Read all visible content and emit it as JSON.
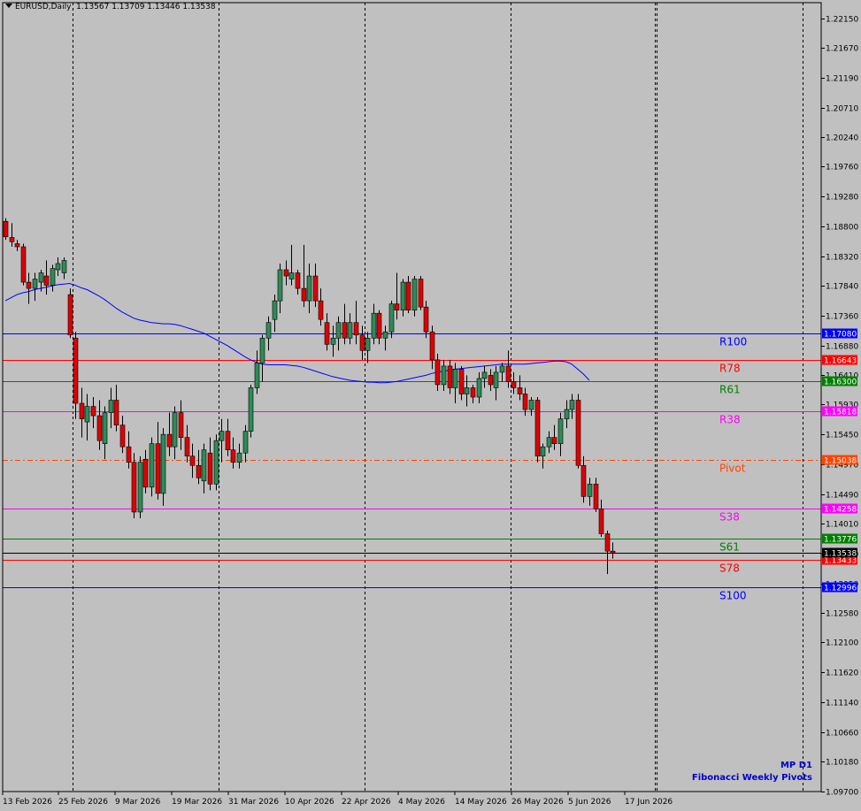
{
  "header": {
    "symbol": "EURUSD,Daily",
    "ohlc": "1.13567 1.13709 1.13446 1.13538"
  },
  "branding": {
    "line1": "MP D1",
    "line2": "Fibonacci Weekly Pivots"
  },
  "colors": {
    "background": "#c0c0c0",
    "bull": "#2e8b57",
    "bear": "#e00000",
    "ma": "#0000ff"
  },
  "chart_data": {
    "type": "candlestick",
    "ylim": [
      1.097,
      1.224
    ],
    "y_ticks": [
      "1.22150",
      "1.21670",
      "1.21190",
      "1.20710",
      "1.20240",
      "1.19760",
      "1.19280",
      "1.18800",
      "1.18320",
      "1.17840",
      "1.17360",
      "1.16880",
      "1.16410",
      "1.15930",
      "1.15450",
      "1.14970",
      "1.14490",
      "1.14010",
      "1.13530",
      "1.13050",
      "1.12580",
      "1.12100",
      "1.11620",
      "1.11140",
      "1.10660",
      "1.10180",
      "1.09700"
    ],
    "x_labels": [
      "13 Feb 2026",
      "25 Feb 2026",
      "9 Mar 2026",
      "19 Mar 2026",
      "31 Mar 2026",
      "10 Apr 2026",
      "22 Apr 2026",
      "4 May 2026",
      "14 May 2026",
      "26 May 2026",
      "5 Jun 2026",
      "17 Jun 2026"
    ],
    "period_separators": [
      12,
      37,
      62,
      87,
      112,
      137
    ],
    "candles": [
      [
        1.1888,
        1.1893,
        1.1858,
        1.1863
      ],
      [
        1.1862,
        1.1885,
        1.1847,
        1.1855
      ],
      [
        1.1852,
        1.1858,
        1.184,
        1.1847
      ],
      [
        1.1847,
        1.1852,
        1.1785,
        1.179
      ],
      [
        1.179,
        1.1805,
        1.1755,
        1.178
      ],
      [
        1.178,
        1.1805,
        1.176,
        1.1795
      ],
      [
        1.179,
        1.181,
        1.1775,
        1.1805
      ],
      [
        1.18,
        1.1825,
        1.177,
        1.1785
      ],
      [
        1.1785,
        1.1818,
        1.1775,
        1.1812
      ],
      [
        1.181,
        1.183,
        1.18,
        1.182
      ],
      [
        1.1805,
        1.183,
        1.1795,
        1.1825
      ],
      [
        1.177,
        1.178,
        1.17,
        1.1705
      ],
      [
        1.17,
        1.171,
        1.157,
        1.1595
      ],
      [
        1.1595,
        1.162,
        1.154,
        1.157
      ],
      [
        1.1565,
        1.161,
        1.1535,
        1.159
      ],
      [
        1.159,
        1.1605,
        1.1555,
        1.1575
      ],
      [
        1.1575,
        1.16,
        1.152,
        1.1535
      ],
      [
        1.153,
        1.159,
        1.1505,
        1.158
      ],
      [
        1.158,
        1.162,
        1.1555,
        1.16
      ],
      [
        1.16,
        1.1625,
        1.155,
        1.156
      ],
      [
        1.156,
        1.1575,
        1.1515,
        1.1525
      ],
      [
        1.1525,
        1.155,
        1.149,
        1.15
      ],
      [
        1.15,
        1.1515,
        1.141,
        1.142
      ],
      [
        1.142,
        1.151,
        1.141,
        1.15
      ],
      [
        1.1505,
        1.152,
        1.145,
        1.146
      ],
      [
        1.146,
        1.154,
        1.1445,
        1.153
      ],
      [
        1.153,
        1.1565,
        1.144,
        1.145
      ],
      [
        1.145,
        1.1555,
        1.143,
        1.1545
      ],
      [
        1.1545,
        1.158,
        1.151,
        1.1525
      ],
      [
        1.1525,
        1.159,
        1.1505,
        1.158
      ],
      [
        1.158,
        1.16,
        1.152,
        1.154
      ],
      [
        1.154,
        1.156,
        1.15,
        1.151
      ],
      [
        1.151,
        1.153,
        1.1475,
        1.1495
      ],
      [
        1.1495,
        1.152,
        1.1465,
        1.1475
      ],
      [
        1.147,
        1.153,
        1.145,
        1.152
      ],
      [
        1.1515,
        1.154,
        1.1455,
        1.1465
      ],
      [
        1.1465,
        1.1545,
        1.1455,
        1.1535
      ],
      [
        1.1535,
        1.157,
        1.15,
        1.155
      ],
      [
        1.155,
        1.157,
        1.151,
        1.152
      ],
      [
        1.152,
        1.154,
        1.149,
        1.15
      ],
      [
        1.15,
        1.153,
        1.149,
        1.1515
      ],
      [
        1.1515,
        1.156,
        1.15,
        1.155
      ],
      [
        1.155,
        1.1625,
        1.154,
        1.162
      ],
      [
        1.162,
        1.168,
        1.161,
        1.166
      ],
      [
        1.166,
        1.1705,
        1.163,
        1.17
      ],
      [
        1.17,
        1.1735,
        1.168,
        1.1725
      ],
      [
        1.173,
        1.177,
        1.171,
        1.176
      ],
      [
        1.176,
        1.182,
        1.174,
        1.181
      ],
      [
        1.181,
        1.1825,
        1.1785,
        1.18
      ],
      [
        1.1795,
        1.185,
        1.1785,
        1.1805
      ],
      [
        1.1805,
        1.181,
        1.177,
        1.178
      ],
      [
        1.178,
        1.185,
        1.175,
        1.176
      ],
      [
        1.176,
        1.182,
        1.174,
        1.18
      ],
      [
        1.18,
        1.182,
        1.175,
        1.176
      ],
      [
        1.176,
        1.178,
        1.172,
        1.173
      ],
      [
        1.1725,
        1.174,
        1.168,
        1.169
      ],
      [
        1.169,
        1.172,
        1.167,
        1.17
      ],
      [
        1.17,
        1.1735,
        1.168,
        1.1725
      ],
      [
        1.1725,
        1.1755,
        1.169,
        1.17
      ],
      [
        1.17,
        1.174,
        1.169,
        1.1725
      ],
      [
        1.1725,
        1.176,
        1.169,
        1.1705
      ],
      [
        1.1705,
        1.172,
        1.1665,
        1.168
      ],
      [
        1.168,
        1.171,
        1.166,
        1.17
      ],
      [
        1.17,
        1.1755,
        1.169,
        1.174
      ],
      [
        1.174,
        1.1745,
        1.169,
        1.17
      ],
      [
        1.17,
        1.172,
        1.168,
        1.171
      ],
      [
        1.171,
        1.176,
        1.17,
        1.1755
      ],
      [
        1.1755,
        1.1805,
        1.173,
        1.1745
      ],
      [
        1.1745,
        1.1795,
        1.1735,
        1.179
      ],
      [
        1.179,
        1.18,
        1.174,
        1.1745
      ],
      [
        1.1745,
        1.18,
        1.1735,
        1.1795
      ],
      [
        1.1795,
        1.18,
        1.1745,
        1.175
      ],
      [
        1.175,
        1.176,
        1.17,
        1.171
      ],
      [
        1.171,
        1.172,
        1.165,
        1.1665
      ],
      [
        1.1665,
        1.1675,
        1.1615,
        1.1625
      ],
      [
        1.1625,
        1.1665,
        1.1615,
        1.1655
      ],
      [
        1.1655,
        1.1665,
        1.161,
        1.162
      ],
      [
        1.162,
        1.166,
        1.1595,
        1.165
      ],
      [
        1.165,
        1.1655,
        1.16,
        1.161
      ],
      [
        1.161,
        1.164,
        1.159,
        1.162
      ],
      [
        1.162,
        1.1625,
        1.1595,
        1.1605
      ],
      [
        1.1605,
        1.1645,
        1.1595,
        1.1635
      ],
      [
        1.1635,
        1.1655,
        1.162,
        1.1645
      ],
      [
        1.164,
        1.165,
        1.1615,
        1.1625
      ],
      [
        1.162,
        1.1655,
        1.16,
        1.1645
      ],
      [
        1.1645,
        1.166,
        1.163,
        1.1655
      ],
      [
        1.1655,
        1.168,
        1.162,
        1.163
      ],
      [
        1.163,
        1.1645,
        1.161,
        1.162
      ],
      [
        1.162,
        1.164,
        1.16,
        1.161
      ],
      [
        1.161,
        1.162,
        1.1575,
        1.1585
      ],
      [
        1.1585,
        1.1605,
        1.1575,
        1.16
      ],
      [
        1.16,
        1.1605,
        1.15,
        1.151
      ],
      [
        1.151,
        1.153,
        1.149,
        1.1525
      ],
      [
        1.1525,
        1.155,
        1.1515,
        1.154
      ],
      [
        1.154,
        1.156,
        1.152,
        1.153
      ],
      [
        1.153,
        1.158,
        1.151,
        1.157
      ],
      [
        1.157,
        1.16,
        1.1555,
        1.1585
      ],
      [
        1.1585,
        1.161,
        1.157,
        1.16
      ],
      [
        1.16,
        1.161,
        1.149,
        1.1495
      ],
      [
        1.1495,
        1.151,
        1.1435,
        1.1445
      ],
      [
        1.1445,
        1.1475,
        1.143,
        1.1465
      ],
      [
        1.1465,
        1.1475,
        1.142,
        1.1425
      ],
      [
        1.1425,
        1.144,
        1.138,
        1.1385
      ],
      [
        1.1385,
        1.139,
        1.132,
        1.1357
      ],
      [
        1.1357,
        1.1371,
        1.1345,
        1.1354
      ]
    ],
    "ma_series": [
      1.176,
      1.1765,
      1.177,
      1.1773,
      1.1775,
      1.1778,
      1.178,
      1.1782,
      1.1784,
      1.1786,
      1.1787,
      1.1788,
      1.1785,
      1.1781,
      1.1778,
      1.1773,
      1.1768,
      1.1762,
      1.1755,
      1.1748,
      1.1742,
      1.1737,
      1.1732,
      1.1729,
      1.1727,
      1.1725,
      1.1724,
      1.1723,
      1.1723,
      1.1722,
      1.172,
      1.1717,
      1.1714,
      1.1711,
      1.1708,
      1.1703,
      1.1698,
      1.1693,
      1.1688,
      1.1682,
      1.1676,
      1.167,
      1.1665,
      1.1661,
      1.1658,
      1.1657,
      1.1657,
      1.1657,
      1.1657,
      1.1656,
      1.1655,
      1.1653,
      1.165,
      1.1647,
      1.1644,
      1.1641,
      1.1638,
      1.1636,
      1.1634,
      1.1632,
      1.1631,
      1.163,
      1.1629,
      1.1629,
      1.1628,
      1.1628,
      1.1629,
      1.163,
      1.1632,
      1.1634,
      1.1636,
      1.1638,
      1.164,
      1.1643,
      1.1645,
      1.1647,
      1.1648,
      1.165,
      1.1651,
      1.1652,
      1.1653,
      1.1654,
      1.1655,
      1.1656,
      1.1657,
      1.1658,
      1.1658,
      1.1658,
      1.1658,
      1.1658,
      1.1659,
      1.166,
      1.1661,
      1.1662,
      1.1663,
      1.1663,
      1.1662,
      1.1658,
      1.165,
      1.1642,
      1.1632
    ],
    "pivot_levels": [
      {
        "name": "R100",
        "value": 1.1708,
        "price_label": "1.17080",
        "color": "#0000ff",
        "style": "solid"
      },
      {
        "name": "R78",
        "value": 1.16643,
        "price_label": "1.16643",
        "color": "#ff0000",
        "style": "solid"
      },
      {
        "name": "R61",
        "value": 1.163,
        "price_label": "1.16300",
        "color": "#008000",
        "style": "solid"
      },
      {
        "name": "R38",
        "value": 1.15818,
        "price_label": "1.15818",
        "color": "#ff00ff",
        "style": "solid"
      },
      {
        "name": "Pivot",
        "value": 1.15038,
        "price_label": "1.15038",
        "color": "#ff4500",
        "style": "dashdot"
      },
      {
        "name": "S38",
        "value": 1.14258,
        "price_label": "1.14258",
        "color": "#ff00ff",
        "style": "solid"
      },
      {
        "name": "S61",
        "value": 1.13776,
        "price_label": "1.13776",
        "color": "#008000",
        "style": "solid"
      },
      {
        "name": "S78",
        "value": 1.13433,
        "price_label": "1.13433",
        "color": "#ff0000",
        "style": "solid"
      },
      {
        "name": "S100",
        "value": 1.12996,
        "price_label": "1.12996",
        "color": "#0000ff",
        "style": "solid"
      }
    ],
    "current_price": {
      "value": 1.13538,
      "price_label": "1.13538",
      "color": "#000000"
    }
  }
}
